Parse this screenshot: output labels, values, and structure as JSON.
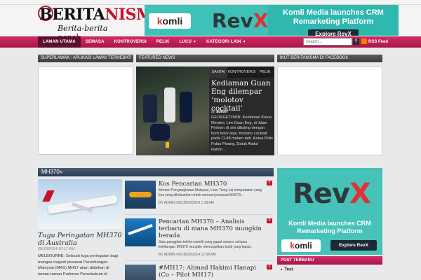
{
  "site": {
    "logo_main_dark": "BERITA",
    "logo_main_red": "NISMA",
    "logo_tagline": "Berita-berita pergh...."
  },
  "top_banner": {
    "brand": "komli",
    "product": "RevX",
    "headline": "Komli Media launches CRM Remarketing Platform",
    "button": "Explore RevX"
  },
  "nav": {
    "items": [
      {
        "label": "LAMAN UTAMA",
        "active": true
      },
      {
        "label": "SEMASA"
      },
      {
        "label": "KONTROVERSI"
      },
      {
        "label": "PELIK"
      },
      {
        "label": "LUCU",
        "dropdown": true
      },
      {
        "label": "KATEGORI LAIN",
        "dropdown": true
      }
    ],
    "search_placeholder": "search...",
    "rss_label": "RSS Feed"
  },
  "boxes": {
    "left_title": "SUPERLAWAK : APLIKASI LAWAK TERHEBAT!",
    "featured_title": "FEATURED NEWS",
    "right_title": "IKUT BERITANISMA DI FACEBOOK"
  },
  "featured": {
    "tabs": [
      "SANTAI",
      "KONTROVERSI",
      "PELIK"
    ],
    "title": "Kediaman Guan Eng dilempar ‘molotov cocktail’",
    "by_prefix": "by",
    "author": "admin",
    "body": "GEORGETOWN: Kediaman Ketua Menteri, Lim Guan Eng, di Jalan Pinhorn di sini dibaling dengan bom botol atau 'molotov cocktail' pada 11.48 malam tadi. Ketua Polis Pulau Pinang, Datuk Abdul Rahim..."
  },
  "section": {
    "title": "MH370»",
    "lead": {
      "title": "Tugu Peringatan MH370 di Australia",
      "date": "08/30/2014 10:17 AM",
      "text": "MELBOURNE: Sebuah tugu peringatan bagi mangsa tragedi pesawat Penerbangan Malaysia (MAS) MH17 akan didirikan di taman-taman Parlimen Persekutuan di"
    },
    "articles": [
      {
        "title": "Kos Pencarian MH370",
        "text": "Menteri Pengangkutan Malaysia, Liow Tiong Lai menyatakan yang kos yang dikeluarkan untuk mencari pesawat MH370...",
        "meta": "BY ADMIN ON 08/29/2014 1:18 AM",
        "comments": "0"
      },
      {
        "title": "Pencarian MH370 – Analisis terbaru di mana MH370 mungkin berada",
        "text": "Satu panggilan telefon setelit yang gagal sejurus selepas kehilangan MH370 mungkin menunjukkan bukti yang kapal...",
        "meta": "BY ADMIN ON 08/29/2014 12:38 AM",
        "comments": "0"
      },
      {
        "title": "#MH17: Ahmad Hakimi Hanapi (Co – Pilot MH17)",
        "comments": "0"
      }
    ]
  },
  "side_ad": {
    "product": "RevX",
    "headline": "Komli Media launches CRM Remarketing Platform",
    "brand": "komli",
    "button": "Explore RevX"
  },
  "recent": {
    "title": "POST TERBARU",
    "items": [
      "Test"
    ]
  }
}
